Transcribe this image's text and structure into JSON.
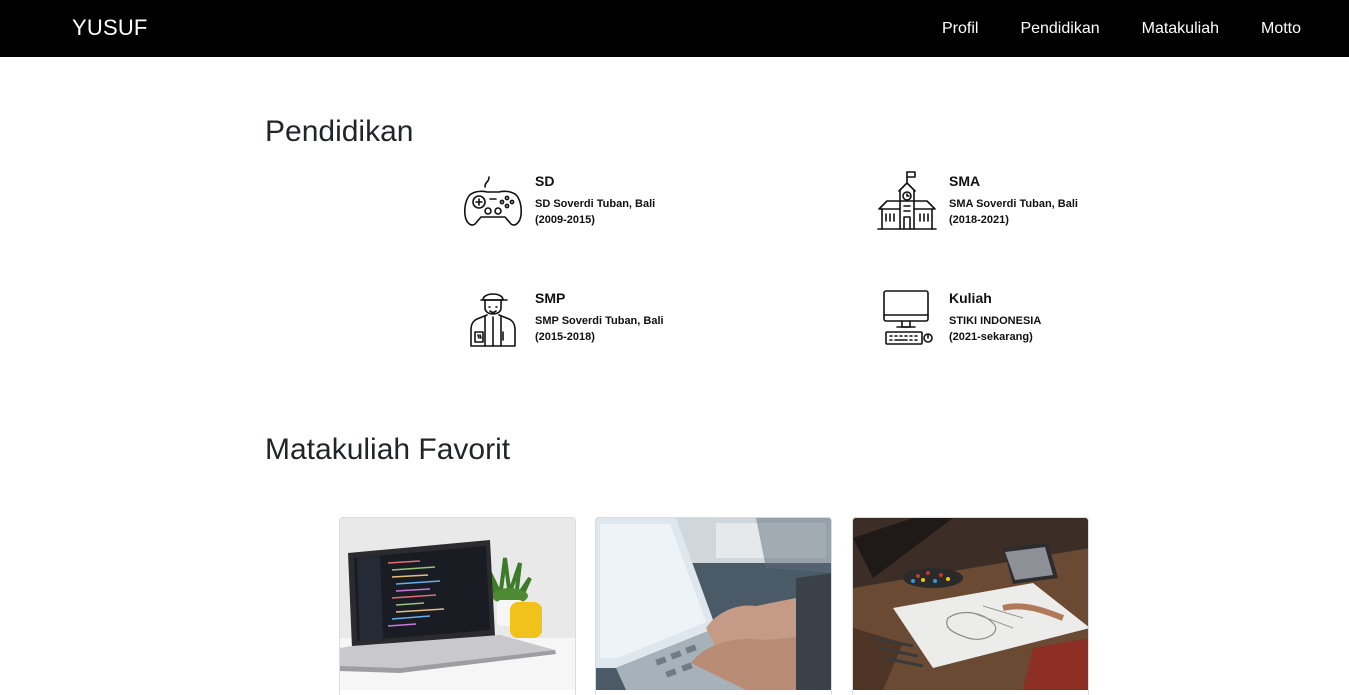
{
  "navbar": {
    "brand": "YUSUF",
    "links": [
      "Profil",
      "Pendidikan",
      "Matakuliah",
      "Motto"
    ]
  },
  "pendidikan": {
    "title": "Pendidikan",
    "items": [
      {
        "name": "SD",
        "school": "SD Soverdi Tuban, Bali",
        "years": "(2009-2015)",
        "icon": "gamepad-icon"
      },
      {
        "name": "SMA",
        "school": "SMA Soverdi Tuban, Bali",
        "years": "(2018-2021)",
        "icon": "school-building-icon"
      },
      {
        "name": "SMP",
        "school": "SMP Soverdi Tuban, Bali",
        "years": "(2015-2018)",
        "icon": "student-icon"
      },
      {
        "name": "Kuliah",
        "school": "STIKI INDONESIA",
        "years": "(2021-sekarang)",
        "icon": "computer-icon"
      }
    ]
  },
  "matakuliah": {
    "title": "Matakuliah Favorit",
    "cards": [
      {
        "image": "laptop-code-photo"
      },
      {
        "image": "typing-hands-photo"
      },
      {
        "image": "drawing-desk-photo"
      }
    ]
  }
}
